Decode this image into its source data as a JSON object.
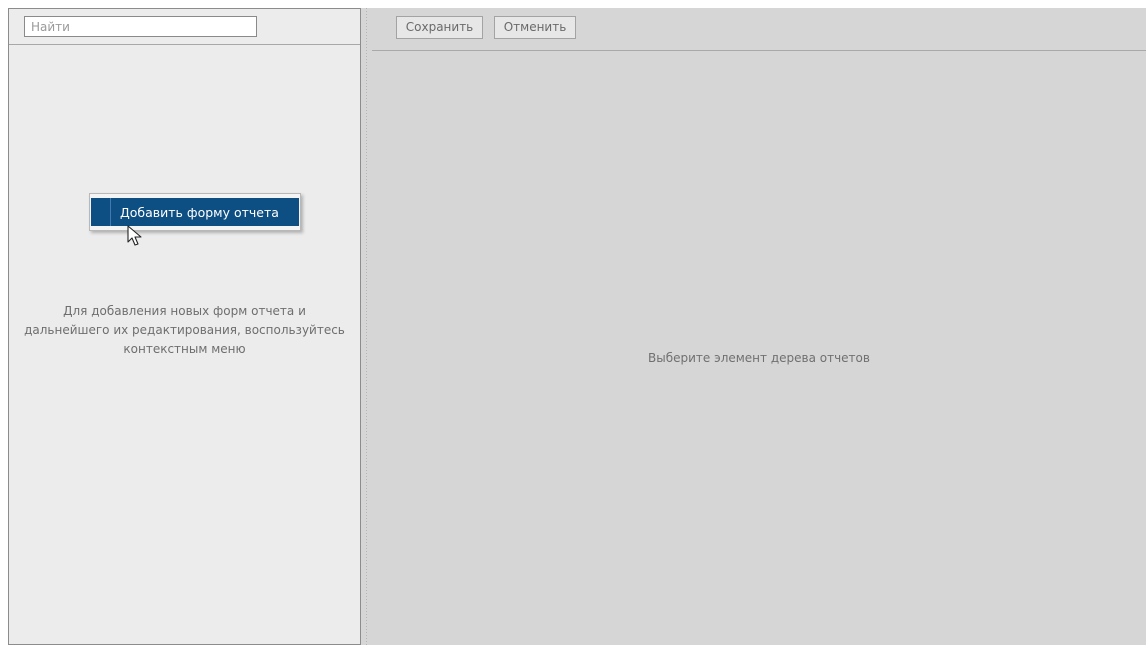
{
  "sidebar": {
    "search": {
      "placeholder": "Найти",
      "value": ""
    },
    "context_menu": {
      "items": [
        {
          "label": "Добавить форму отчета"
        }
      ]
    },
    "hint": "Для добавления новых форм отчета и\nдальнейшего их редактирования, воспользуйтесь\nконтекстным меню"
  },
  "toolbar": {
    "save_label": "Сохранить",
    "cancel_label": "Отменить"
  },
  "main": {
    "empty_message": "Выберите элемент дерева отчетов"
  },
  "colors": {
    "menu_highlight": "#0e4f83",
    "panel_background": "#ececec",
    "workspace_background": "#d6d6d6"
  }
}
